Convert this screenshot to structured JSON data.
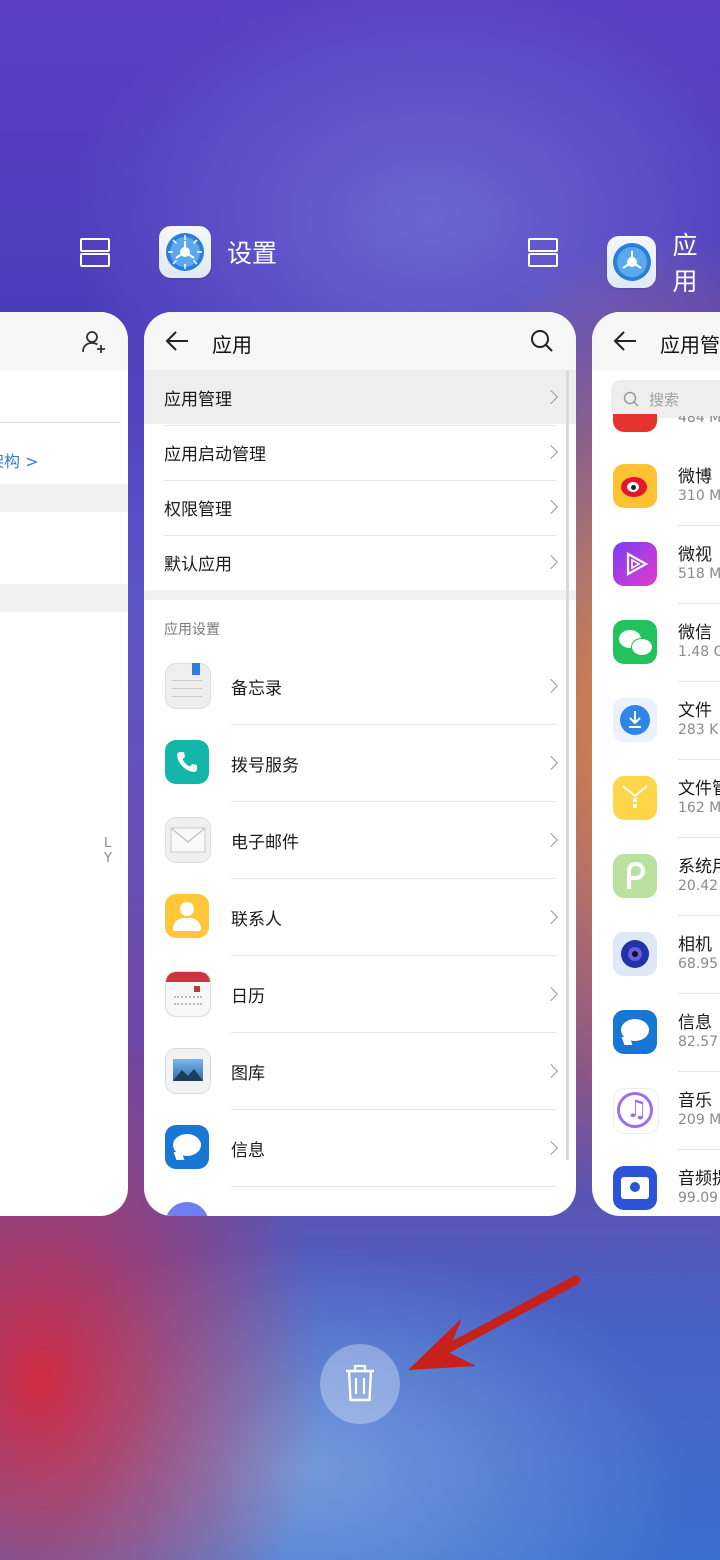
{
  "recents": {
    "left_app": {
      "header_icons": [
        "window-split-icon",
        "add-contact-icon"
      ],
      "link_text": "识架构 >",
      "side_letters": "L\nY"
    },
    "center_app": {
      "name": "设置",
      "title": "应用",
      "menu": [
        {
          "label": "应用管理"
        },
        {
          "label": "应用启动管理"
        },
        {
          "label": "权限管理"
        },
        {
          "label": "默认应用"
        }
      ],
      "section_title": "应用设置",
      "apps": [
        {
          "label": "备忘录",
          "icon": "notes-icon"
        },
        {
          "label": "拨号服务",
          "icon": "phone-icon"
        },
        {
          "label": "电子邮件",
          "icon": "mail-icon"
        },
        {
          "label": "联系人",
          "icon": "contacts-icon"
        },
        {
          "label": "日历",
          "icon": "calendar-icon"
        },
        {
          "label": "图库",
          "icon": "gallery-icon"
        },
        {
          "label": "信息",
          "icon": "messages-icon"
        }
      ]
    },
    "right_app": {
      "name": "应用",
      "title": "应用管",
      "search_placeholder": "搜索",
      "top_partial_size": "484 M",
      "apps": [
        {
          "name": "微博",
          "size": "310 M",
          "icon": "weibo-icon"
        },
        {
          "name": "微视",
          "size": "518 M",
          "icon": "weishi-icon"
        },
        {
          "name": "微信",
          "size": "1.48 G",
          "icon": "wechat-icon"
        },
        {
          "name": "文件",
          "size": "283 K",
          "icon": "download-icon"
        },
        {
          "name": "文件管",
          "size": "162 M",
          "icon": "files-icon"
        },
        {
          "name": "系统用",
          "size": "20.42",
          "icon": "android-p-icon"
        },
        {
          "name": "相机",
          "size": "68.95",
          "icon": "camera-icon"
        },
        {
          "name": "信息",
          "size": "82.57",
          "icon": "messages-icon"
        },
        {
          "name": "音乐",
          "size": "209 M",
          "icon": "music-icon"
        },
        {
          "name": "音频提",
          "size": "99.09",
          "icon": "audio-extract-icon"
        }
      ]
    },
    "clear_all": {
      "icon": "trash-icon"
    },
    "annotation": {
      "arrow_color": "#c8201a"
    }
  }
}
